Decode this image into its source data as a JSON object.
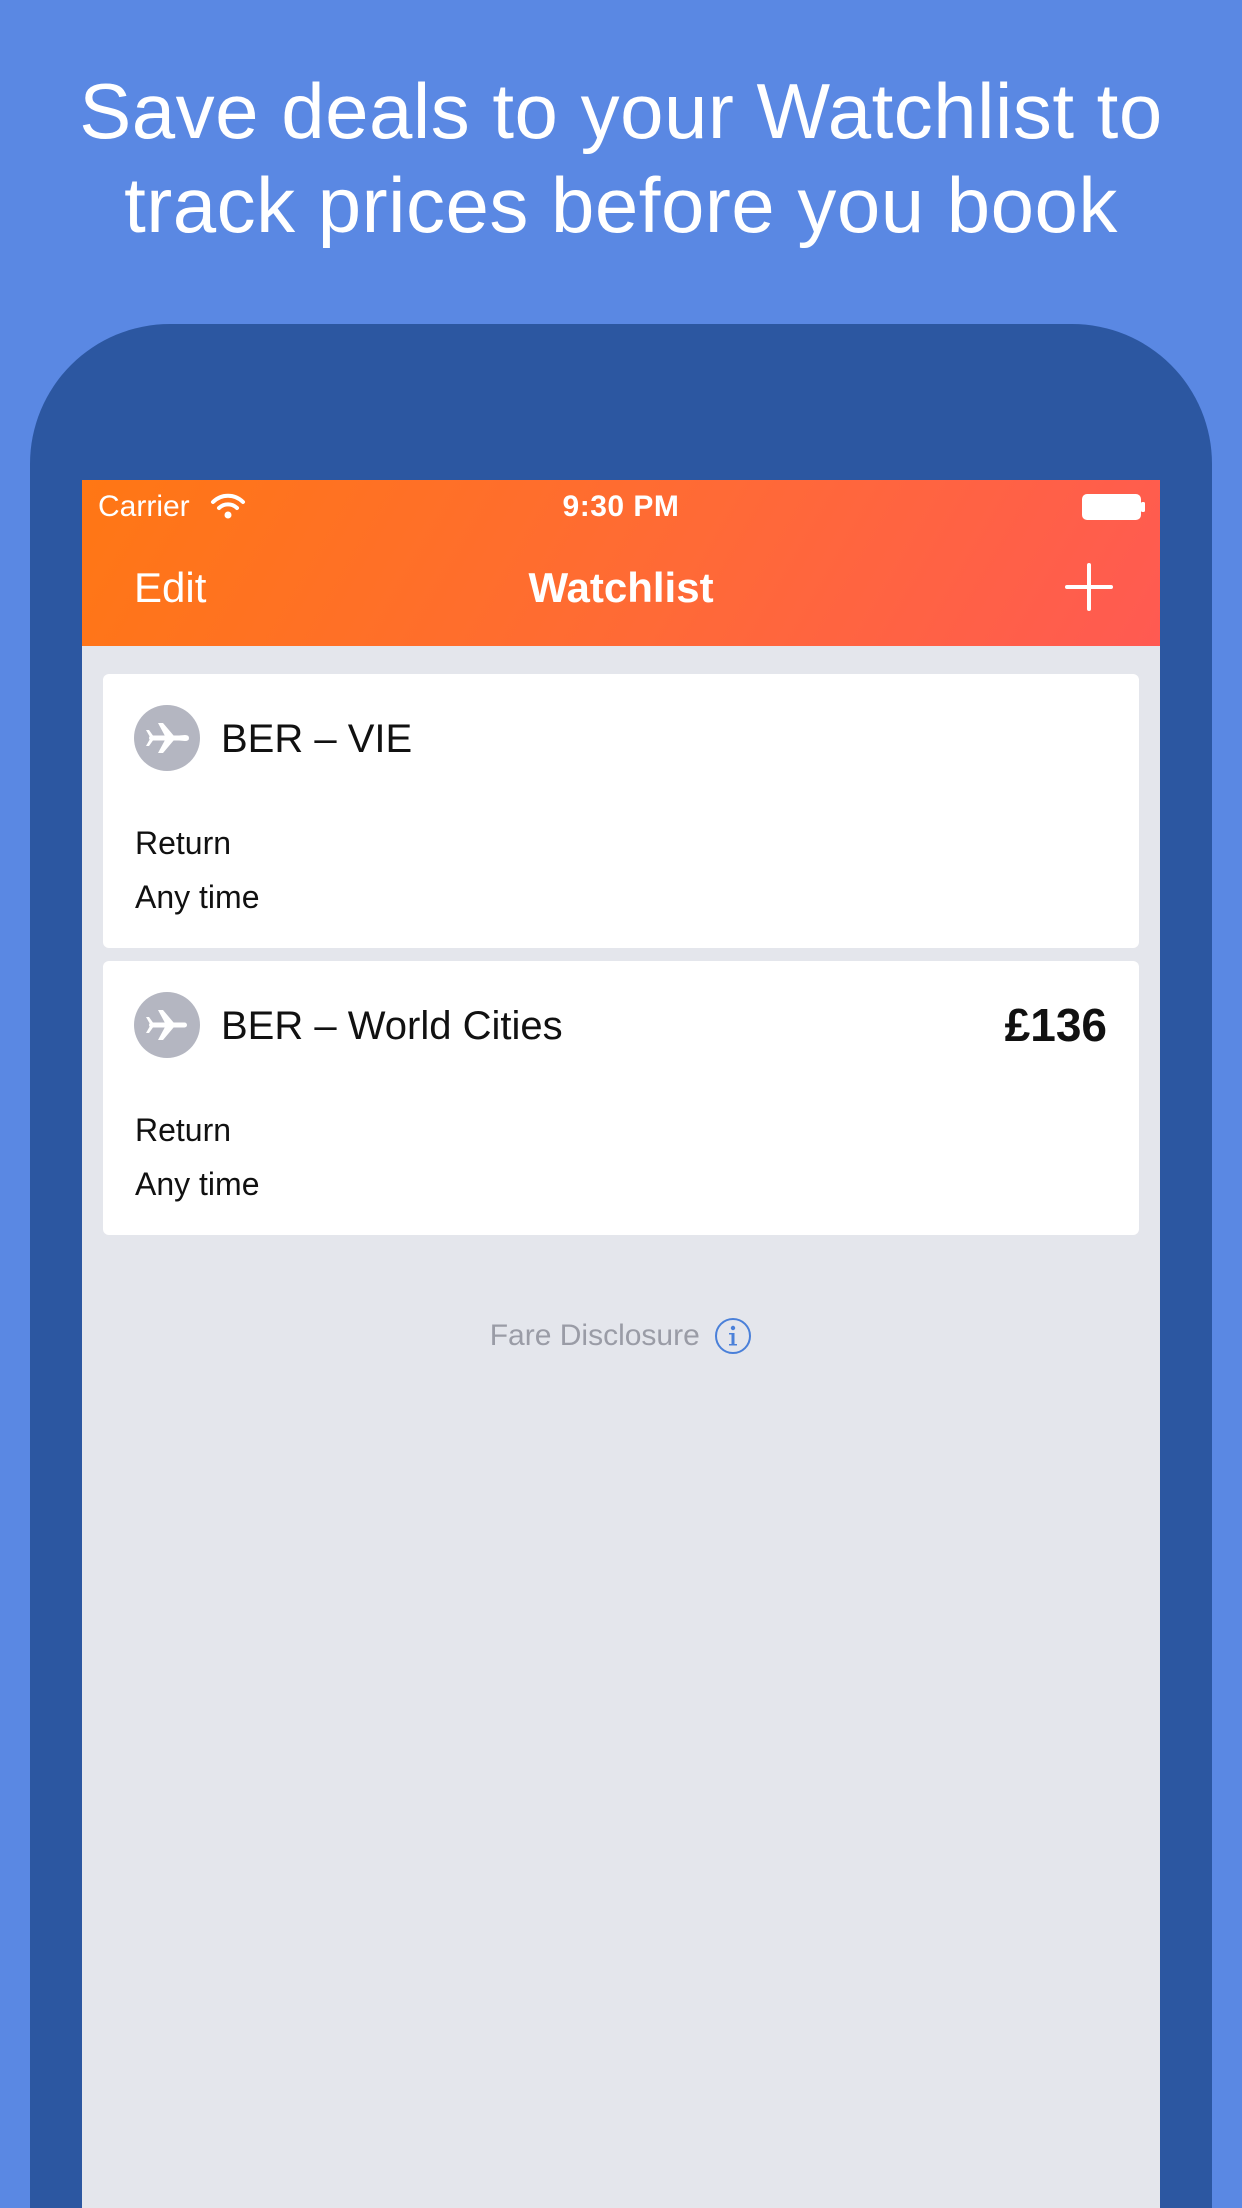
{
  "promo": {
    "headline_line1": "Save deals to your Watchlist to",
    "headline_line2": "track prices before you book"
  },
  "status_bar": {
    "carrier": "Carrier",
    "time": "9:30 PM",
    "icons": [
      "wifi-icon",
      "battery-icon"
    ]
  },
  "navbar": {
    "left_label": "Edit",
    "title": "Watchlist",
    "right_icon": "plus-icon"
  },
  "watchlist": [
    {
      "icon": "plane-icon",
      "route": "BER – VIE",
      "price": "",
      "trip_type": "Return",
      "timeframe": "Any time"
    },
    {
      "icon": "plane-icon",
      "route": "BER – World Cities",
      "price": "£136",
      "trip_type": "Return",
      "timeframe": "Any time"
    }
  ],
  "footer": {
    "fare_disclosure": "Fare Disclosure",
    "icon": "info-icon"
  },
  "colors": {
    "background": "#5A88E3",
    "phone_frame": "#2C57A1",
    "nav_gradient_start": "#FF7714",
    "nav_gradient_end": "#FF5A52",
    "screen_background": "#E4E6EC",
    "plane_badge": "#B4B6C1",
    "info_accent": "#4A80D9"
  }
}
